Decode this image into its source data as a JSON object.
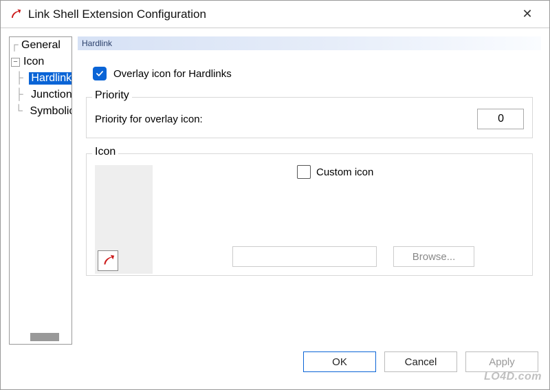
{
  "window": {
    "title": "Link Shell Extension Configuration"
  },
  "tree": {
    "items": [
      {
        "label": "General",
        "depth": 0,
        "selected": false,
        "expander": null
      },
      {
        "label": "Icon",
        "depth": 0,
        "selected": false,
        "expander": "minus"
      },
      {
        "label": "Hardlink",
        "depth": 1,
        "selected": true,
        "expander": null
      },
      {
        "label": "Junction",
        "depth": 1,
        "selected": false,
        "expander": null
      },
      {
        "label": "Symbolic",
        "depth": 1,
        "selected": false,
        "expander": null
      }
    ]
  },
  "tab": {
    "label": "Hardlink"
  },
  "overlay_checkbox": {
    "checked": true,
    "label": "Overlay icon for Hardlinks"
  },
  "priority_group": {
    "legend": "Priority",
    "label": "Priority for overlay icon:",
    "value": "0"
  },
  "icon_group": {
    "legend": "Icon",
    "custom_label": "Custom icon",
    "custom_checked": false,
    "browse_label": "Browse...",
    "path_value": ""
  },
  "buttons": {
    "ok": "OK",
    "cancel": "Cancel",
    "apply": "Apply"
  },
  "watermark": "LO4D.com",
  "colors": {
    "accent": "#0a64d6"
  }
}
